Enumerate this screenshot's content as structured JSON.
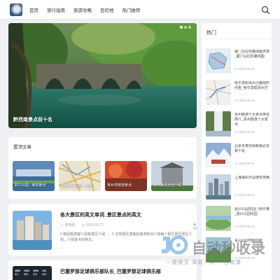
{
  "nav": {
    "items": [
      {
        "label": "首页"
      },
      {
        "label": "旅行指南"
      },
      {
        "label": "旅游攻略"
      },
      {
        "label": "目的地"
      },
      {
        "label": "热门推荐"
      }
    ],
    "search_icon": "search-icon"
  },
  "hero": {
    "caption": "黔西南景点前十名",
    "slides": 3,
    "active_slide": 1
  },
  "featured": {
    "title": "置顶文章",
    "cards": [
      {
        "label": "黔江公园 · 荣县景点"
      },
      {
        "label": "长安区卫生局 · 七景"
      },
      {
        "label": "常州市旅游景点"
      },
      {
        "label": "桂林景点大全介绍"
      }
    ]
  },
  "article1": {
    "title": "各大景区的英文单词_景区景点的英文",
    "author": "旅游网",
    "date": "2024-05-27",
    "count": "95",
    "summary": "1.她回报游客介绍各景区介绍……2.当地景区游客给旅游景点介绍每个景区景区景区介绍，介绍景点的英文。"
  },
  "article2": {
    "title": "巴塞罗那足球俱乐部队长_巴塞罗那足球俱乐部",
    "stats": [
      {
        "value": "1899",
        "label": "成立"
      },
      {
        "value": "1929",
        "label": "联赛"
      },
      {
        "value": "1996",
        "label": "年份"
      },
      {
        "value": "194",
        "label": "进球"
      }
    ]
  },
  "sidebar": {
    "title": "热门",
    "items": [
      {
        "title": "厦门马拉松路线图环境_厦门马拉松路线图",
        "date": "2024-05-26",
        "icon": "map-thumbnail"
      },
      {
        "title": "哈尔滨机场大巴路线时间查_哈尔滨机场大巴",
        "date": "2024-05-28",
        "icon": "map-thumbnail"
      },
      {
        "title": "贵州旅游十大景点排名简介_贵州旅游十大景点",
        "date": "2024-05-26",
        "icon": "waterfall-thumbnail"
      },
      {
        "title": "北京冬奥项目概要必去景十处",
        "date": "2024-05-17",
        "icon": "snow-thumbnail"
      },
      {
        "title": "上海浦东乐园游玩攻略",
        "date": "2024-05-21",
        "icon": "city-thumbnail"
      },
      {
        "title": "嘉兴公园花园门票价格_嘉兴公园花园",
        "date": "2024-05-22",
        "icon": "landscape-thumbnail"
      },
      {
        "title": "青山公园地图导航",
        "date": "2024-05-23",
        "icon": "landscape-thumbnail"
      }
    ]
  },
  "watermark": {
    "brand": "自动秒收录",
    "slogan": "一键提交 来就一次 一日收录"
  },
  "colors": {
    "page_bg": "#eef0f3",
    "card_bg": "#ffffff",
    "watermark_blue": "#7fb3e0"
  }
}
